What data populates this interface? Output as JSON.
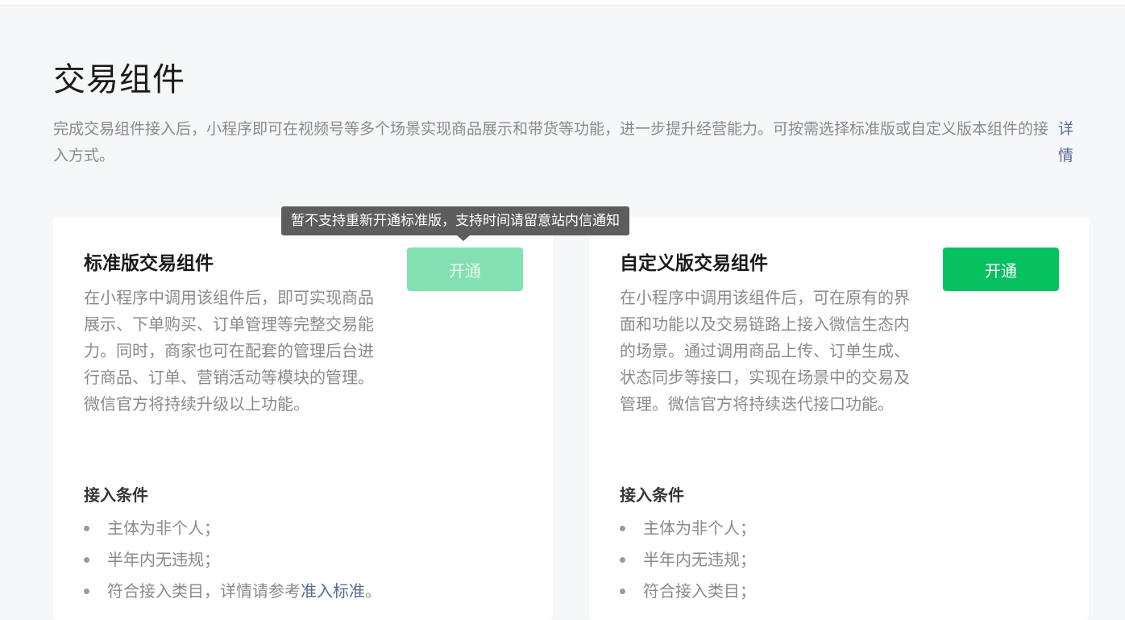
{
  "page": {
    "title": "交易组件",
    "intro": "完成交易组件接入后，小程序即可在视频号等多个场景实现商品展示和带货等功能，进一步提升经营能力。可按需选择标准版或自定义版本组件的接入方式。",
    "detail_link": "详情"
  },
  "tooltip": {
    "text": "暂不支持重新开通标准版，支持时间请留意站内信通知"
  },
  "cards": {
    "standard": {
      "title": "标准版交易组件",
      "description": "在小程序中调用该组件后，即可实现商品展示、下单购买、订单管理等完整交易能力。同时，商家也可在配套的管理后台进行商品、订单、营销活动等模块的管理。微信官方将持续升级以上功能。",
      "button_label": "开通",
      "button_state": "disabled",
      "conditions_title": "接入条件",
      "conditions": {
        "c1": "主体为非个人；",
        "c2": "半年内无违规；",
        "c3_prefix": "符合接入类目，详情请参考",
        "c3_link": "准入标准",
        "c3_suffix": "。"
      }
    },
    "custom": {
      "title": "自定义版交易组件",
      "description": "在小程序中调用该组件后，可在原有的界面和功能以及交易链路上接入微信生态内的场景。通过调用商品上传、订单生成、状态同步等接口，实现在场景中的交易及管理。微信官方将持续迭代接口功能。",
      "button_label": "开通",
      "button_state": "enabled",
      "conditions_title": "接入条件",
      "conditions": {
        "c1": "主体为非个人；",
        "c2": "半年内无违规；",
        "c3": "符合接入类目；"
      }
    }
  },
  "colors": {
    "primary_green": "#07c160",
    "disabled_green": "#83e0b0",
    "link_blue": "#576b95",
    "tooltip_bg": "#5d5d5d",
    "page_bg": "#f6f7f9"
  }
}
